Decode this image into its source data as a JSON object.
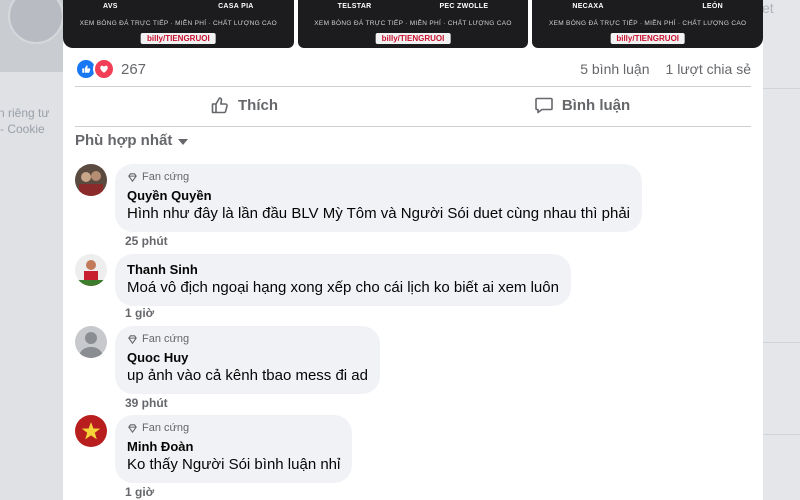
{
  "background": {
    "privacy_text": "n riêng tư",
    "cookie_text": "- Cookie",
    "right_text": "et"
  },
  "banners": [
    {
      "team_left": "AVS",
      "team_right": "CASA PIA",
      "tagline": "XEM BÓNG ĐÁ TRỰC TIẾP · MIỄN PHÍ · CHẤT LƯỢNG CAO",
      "brand": "billy/TIENGRUOI"
    },
    {
      "team_left": "TELSTAR",
      "team_right": "PEC ZWOLLE",
      "tagline": "XEM BÓNG ĐÁ TRỰC TIẾP · MIỄN PHÍ · CHẤT LƯỢNG CAO",
      "brand": "billy/TIENGRUOI"
    },
    {
      "team_left": "NECAXA",
      "team_right": "LEÓN",
      "tagline": "XEM BÓNG ĐÁ TRỰC TIẾP · MIỄN PHÍ · CHẤT LƯỢNG CAO",
      "brand": "billy/TIENGRUOI"
    }
  ],
  "reactions": {
    "count": "267",
    "comments": "5 bình luận",
    "shares": "1 lượt chia sẻ",
    "colors": {
      "like": "#1877f2",
      "love": "#f33e58"
    }
  },
  "actions": {
    "like_label": "Thích",
    "comment_label": "Bình luận"
  },
  "sort_label": "Phù hợp nhất",
  "comments": [
    {
      "badge": "Fan cứng",
      "name": "Quyền Quyền",
      "text": "Hình như đây là lần đầu BLV Mỳ Tôm và Người Sói duet cùng nhau thì phải",
      "time": "25 phút"
    },
    {
      "badge": "",
      "name": "Thanh Sinh",
      "text": "Moá vô địch ngoại hạng xong xếp cho cái lịch ko biết ai xem luôn",
      "time": "1 giờ"
    },
    {
      "badge": "Fan cứng",
      "name": "Quoc Huy",
      "text": "up ảnh vào cả kênh tbao mess đi ad",
      "time": "39 phút"
    },
    {
      "badge": "Fan cứng",
      "name": "Minh Đoàn",
      "text": "Ko thấy Người Sói bình luận nhỉ",
      "time": "1 giờ"
    }
  ]
}
